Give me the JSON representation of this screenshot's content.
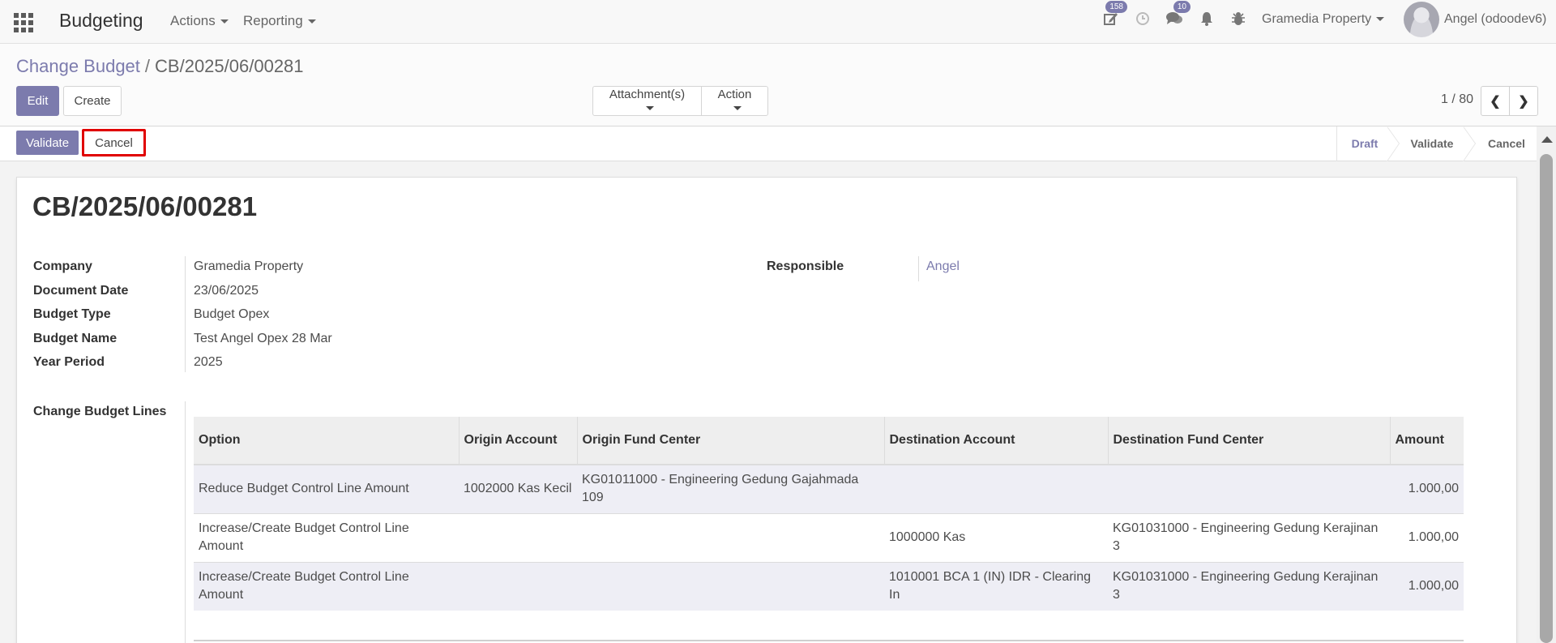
{
  "navbar": {
    "app_name": "Budgeting",
    "menus": [
      "Actions",
      "Reporting"
    ],
    "activity_badge": "158",
    "messages_badge": "10",
    "company": "Gramedia Property",
    "user": "Angel (odoodev6)"
  },
  "breadcrumb": {
    "parent": "Change Budget",
    "separator": "/",
    "current": "CB/2025/06/00281"
  },
  "toolbar": {
    "edit_label": "Edit",
    "create_label": "Create",
    "attachments_label": "Attachment(s)",
    "action_label": "Action",
    "pager_value": "1 / 80"
  },
  "statusbar": {
    "validate_label": "Validate",
    "cancel_label": "Cancel",
    "stages": [
      "Draft",
      "Validate",
      "Cancel"
    ],
    "active_stage": "Draft"
  },
  "form": {
    "title": "CB/2025/06/00281",
    "fields": {
      "company_label": "Company",
      "company": "Gramedia Property",
      "document_date_label": "Document Date",
      "document_date": "23/06/2025",
      "budget_type_label": "Budget Type",
      "budget_type": "Budget Opex",
      "budget_name_label": "Budget Name",
      "budget_name": "Test Angel Opex 28 Mar",
      "year_period_label": "Year Period",
      "year_period": "2025",
      "responsible_label": "Responsible",
      "responsible": "Angel"
    },
    "lines_label": "Change Budget Lines",
    "lines_columns": [
      "Option",
      "Origin Account",
      "Origin Fund Center",
      "Destination Account",
      "Destination Fund Center",
      "Amount"
    ],
    "lines": [
      {
        "option": "Reduce Budget Control Line Amount",
        "origin_account": "1002000 Kas Kecil",
        "origin_fund_center": "KG01011000 - Engineering Gedung Gajahmada 109",
        "destination_account": "",
        "destination_fund_center": "",
        "amount": "1.000,00"
      },
      {
        "option": "Increase/Create Budget Control Line Amount",
        "origin_account": "",
        "origin_fund_center": "",
        "destination_account": "1000000 Kas",
        "destination_fund_center": "KG01031000 - Engineering Gedung Kerajinan 3",
        "amount": "1.000,00"
      },
      {
        "option": "Increase/Create Budget Control Line Amount",
        "origin_account": "",
        "origin_fund_center": "",
        "destination_account": "1010001 BCA 1 (IN) IDR - Clearing In",
        "destination_fund_center": "KG01031000 - Engineering Gedung Kerajinan 3",
        "amount": "1.000,00"
      }
    ]
  },
  "colors": {
    "primary": "#7c7bad",
    "highlight_border": "#e00000"
  }
}
